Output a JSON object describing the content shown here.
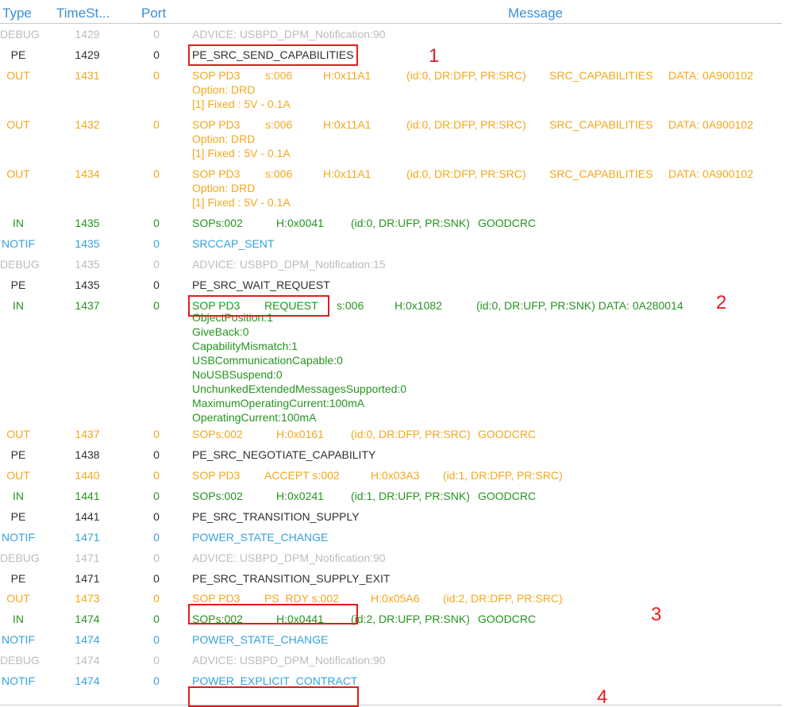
{
  "header": {
    "type": "Type",
    "timestamp": "TimeSt...",
    "port": "Port",
    "message": "Message"
  },
  "colors": {
    "header": "#3a8fd6",
    "debug": "#b9bcc0",
    "pe": "#303030",
    "out": "#f3a71c",
    "in": "#25941e",
    "notif": "#34a3dc",
    "highlight": "#e01d1d"
  },
  "rows": [
    {
      "type": "DEBUG",
      "time": "1429",
      "port": "0",
      "msg": [
        "ADVICE: USBPD_DPM_Notification:90"
      ]
    },
    {
      "type": "PE",
      "time": "1429",
      "port": "0",
      "msg": [
        "PE_SRC_SEND_CAPABILITIES"
      ]
    },
    {
      "type": "OUT",
      "time": "1431",
      "port": "0",
      "msg": [
        "SOP PD3",
        "s:006",
        "H:0x11A1",
        "(id:0, DR:DFP, PR:SRC)",
        "SRC_CAPABILITIES",
        "DATA: 0A900102"
      ],
      "sub": [
        "Option:  DRD",
        "[1] Fixed : 5V - 0.1A"
      ]
    },
    {
      "type": "OUT",
      "time": "1432",
      "port": "0",
      "msg": [
        "SOP PD3",
        "s:006",
        "H:0x11A1",
        "(id:0, DR:DFP, PR:SRC)",
        "SRC_CAPABILITIES",
        "DATA: 0A900102"
      ],
      "sub": [
        "Option:  DRD",
        "[1] Fixed : 5V - 0.1A"
      ]
    },
    {
      "type": "OUT",
      "time": "1434",
      "port": "0",
      "msg": [
        "SOP PD3",
        "s:006",
        "H:0x11A1",
        "(id:0, DR:DFP, PR:SRC)",
        "SRC_CAPABILITIES",
        "DATA: 0A900102"
      ],
      "sub": [
        "Option:  DRD",
        "[1] Fixed : 5V - 0.1A"
      ]
    },
    {
      "type": "IN",
      "time": "1435",
      "port": "0",
      "msg": [
        "SOPs:002",
        "H:0x0041",
        "(id:0, DR:UFP, PR:SNK)",
        "GOODCRC"
      ]
    },
    {
      "type": "NOTIF",
      "time": "1435",
      "port": "0",
      "msg": [
        "SRCCAP_SENT"
      ]
    },
    {
      "type": "DEBUG",
      "time": "1435",
      "port": "0",
      "msg": [
        "ADVICE: USBPD_DPM_Notification:15"
      ]
    },
    {
      "type": "PE",
      "time": "1435",
      "port": "0",
      "msg": [
        "PE_SRC_WAIT_REQUEST"
      ]
    },
    {
      "type": "IN",
      "time": "1437",
      "port": "0",
      "msg": [
        "SOP PD3",
        "REQUEST",
        "s:006",
        "H:0x1082",
        "(id:0, DR:UFP, PR:SNK)  DATA: 0A280014"
      ],
      "sub": [
        "ObjectPosition:1",
        "GiveBack:0",
        "CapabilityMismatch:1",
        "USBCommunicationCapable:0",
        "NoUSBSuspend:0",
        "UnchunkedExtendedMessagesSupported:0",
        "MaximumOperatingCurrent:100mA",
        "OperatingCurrent:100mA"
      ]
    },
    {
      "type": "OUT",
      "time": "1437",
      "port": "0",
      "msg": [
        "SOPs:002",
        "H:0x0161",
        "(id:0, DR:DFP, PR:SRC)",
        "GOODCRC"
      ]
    },
    {
      "type": "PE",
      "time": "1438",
      "port": "0",
      "msg": [
        "PE_SRC_NEGOTIATE_CAPABILITY"
      ]
    },
    {
      "type": "OUT",
      "time": "1440",
      "port": "0",
      "msg": [
        "SOP PD3",
        "ACCEPT s:002",
        "H:0x03A3",
        "(id:1, DR:DFP, PR:SRC)"
      ]
    },
    {
      "type": "IN",
      "time": "1441",
      "port": "0",
      "msg": [
        "SOPs:002",
        "H:0x0241",
        "(id:1, DR:UFP, PR:SNK)",
        "GOODCRC"
      ]
    },
    {
      "type": "PE",
      "time": "1441",
      "port": "0",
      "msg": [
        "PE_SRC_TRANSITION_SUPPLY"
      ]
    },
    {
      "type": "NOTIF",
      "time": "1471",
      "port": "0",
      "msg": [
        "POWER_STATE_CHANGE"
      ]
    },
    {
      "type": "DEBUG",
      "time": "1471",
      "port": "0",
      "msg": [
        "ADVICE: USBPD_DPM_Notification:90"
      ]
    },
    {
      "type": "PE",
      "time": "1471",
      "port": "0",
      "msg": [
        "PE_SRC_TRANSITION_SUPPLY_EXIT"
      ]
    },
    {
      "type": "OUT",
      "time": "1473",
      "port": "0",
      "msg": [
        "SOP PD3",
        "PS_RDY  s:002",
        "H:0x05A6",
        "(id:2, DR:DFP, PR:SRC)"
      ]
    },
    {
      "type": "IN",
      "time": "1474",
      "port": "0",
      "msg": [
        "SOPs:002",
        "H:0x0441",
        "(id:2, DR:UFP, PR:SNK)",
        "GOODCRC"
      ]
    },
    {
      "type": "NOTIF",
      "time": "1474",
      "port": "0",
      "msg": [
        "POWER_STATE_CHANGE"
      ]
    },
    {
      "type": "DEBUG",
      "time": "1474",
      "port": "0",
      "msg": [
        "ADVICE: USBPD_DPM_Notification:90"
      ]
    },
    {
      "type": "NOTIF",
      "time": "1474",
      "port": "0",
      "msg": [
        "POWER_EXPLICIT_CONTRACT"
      ]
    }
  ],
  "annotations": [
    "1",
    "2",
    "3",
    "4"
  ]
}
